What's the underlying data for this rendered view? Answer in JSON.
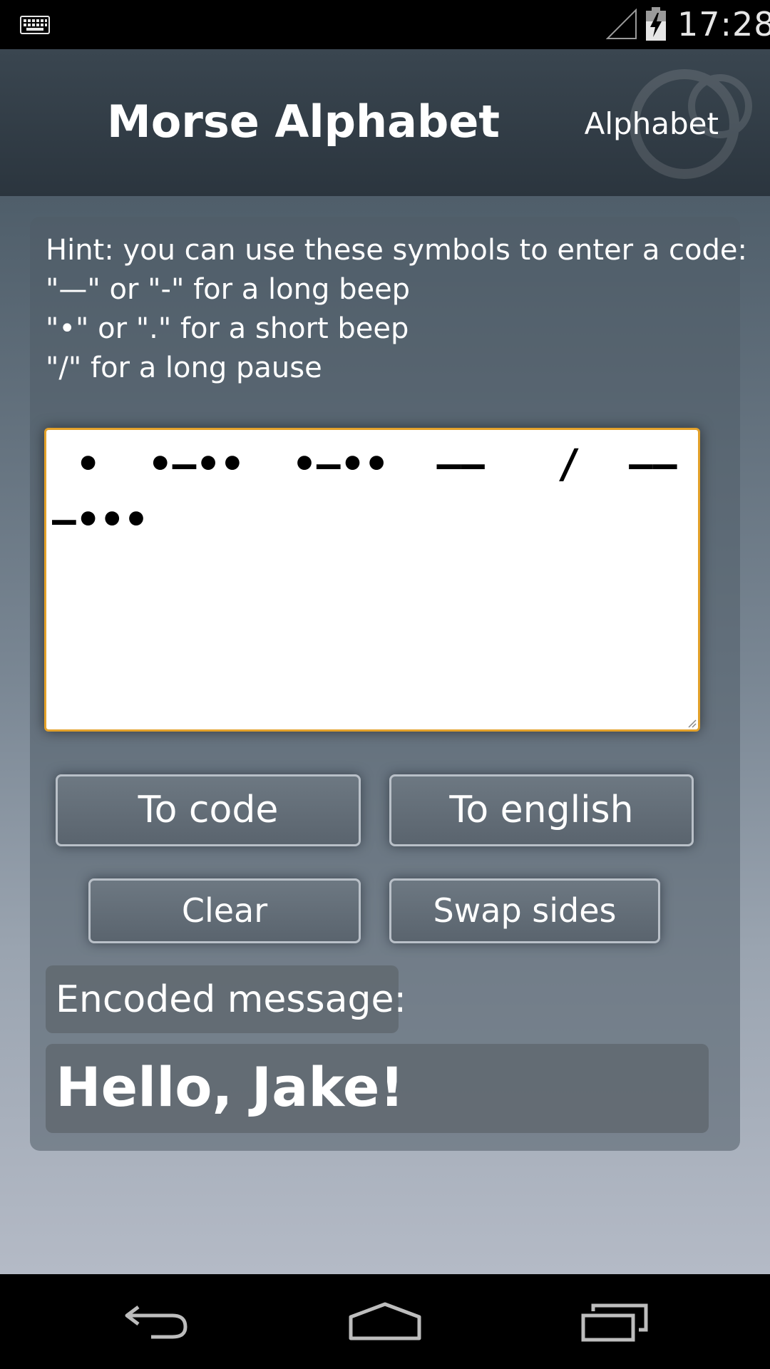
{
  "status_bar": {
    "time": "17:28",
    "icons": [
      "keyboard-icon",
      "signal-icon",
      "battery-charging-icon"
    ]
  },
  "action_bar": {
    "title": "Morse Alphabet",
    "menu_item": "Alphabet"
  },
  "hint": {
    "text": "Hint: you can use these symbols to enter a code:\n\"—\" or \"-\" for a long beep\n\"•\" or \".\" for a short beep\n\"/\" for a long pause"
  },
  "code_input": {
    "value": " •  •—••  •—••  ——   /  ——  —•••"
  },
  "buttons": {
    "to_code": "To code",
    "to_english": "To english",
    "clear": "Clear",
    "swap_sides": "Swap sides"
  },
  "result": {
    "label": "Encoded message:",
    "message": "Hello, Jake!"
  },
  "nav_bar": {
    "icons": [
      "back-icon",
      "home-icon",
      "recent-apps-icon"
    ]
  },
  "colors": {
    "accent_border": "#e3a12a",
    "action_bar": "#2b353e",
    "button_bg": "#5a646e"
  }
}
